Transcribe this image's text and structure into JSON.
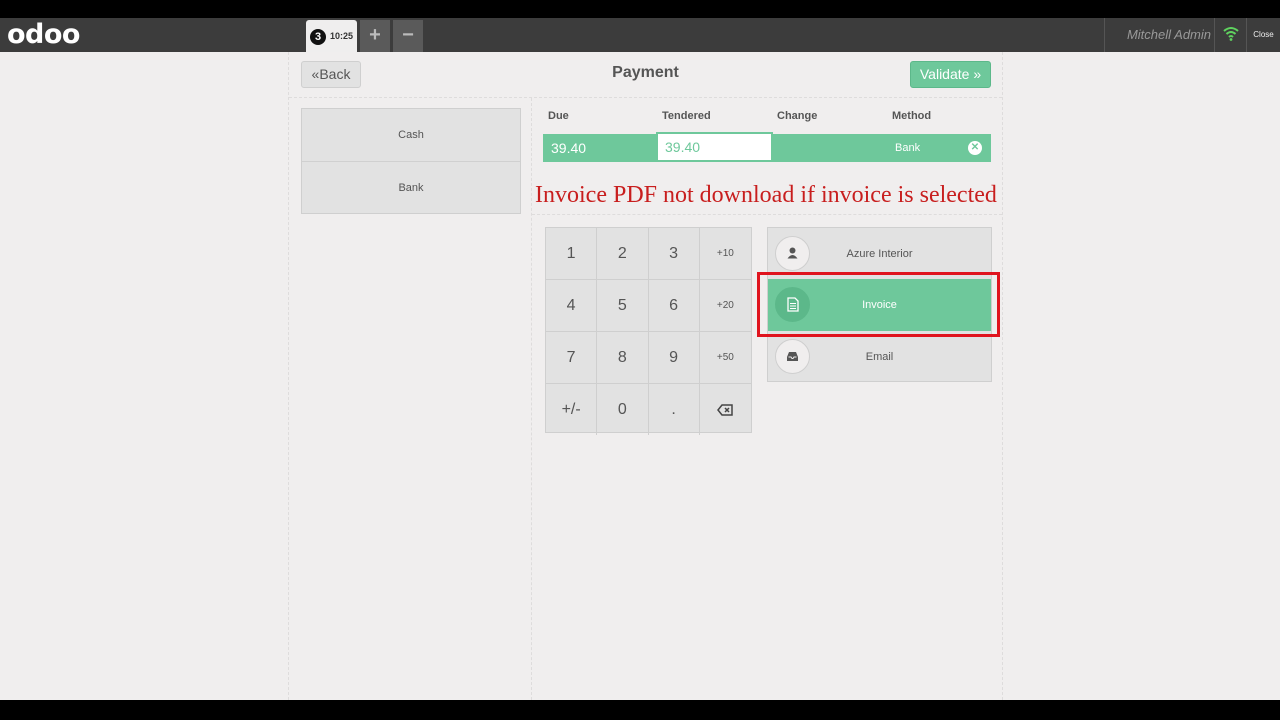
{
  "topbar": {
    "logo": "odoo",
    "order_number": "3",
    "order_time": "10:25",
    "add_order": "+",
    "remove_order": "−",
    "user_name": "Mitchell Admin",
    "close_label": "Close"
  },
  "header": {
    "back_label": "Back",
    "title": "Payment",
    "validate_label": "Validate"
  },
  "payment_methods": [
    {
      "label": "Cash"
    },
    {
      "label": "Bank"
    }
  ],
  "paymentlines": {
    "headers": {
      "due": "Due",
      "tendered": "Tendered",
      "change": "Change",
      "method": "Method"
    },
    "line": {
      "due": "39.40",
      "tendered": "39.40",
      "change": "",
      "method": "Bank"
    }
  },
  "annotation": "Invoice PDF not download if invoice is selected",
  "numpad": [
    "1",
    "2",
    "3",
    "+10",
    "4",
    "5",
    "6",
    "+20",
    "7",
    "8",
    "9",
    "+50",
    "+/-",
    "0",
    ".",
    "backspace"
  ],
  "actions": [
    {
      "label": "Azure Interior",
      "icon": "user-icon",
      "selected": false
    },
    {
      "label": "Invoice",
      "icon": "file-text-icon",
      "selected": true
    },
    {
      "label": "Email",
      "icon": "inbox-icon",
      "selected": false
    }
  ],
  "colors": {
    "topbar": "#3c3c3c",
    "background": "#f0eeee",
    "accent": "#6ec89b",
    "annotation": "#c81e1e",
    "highlight": "#e0141e"
  }
}
